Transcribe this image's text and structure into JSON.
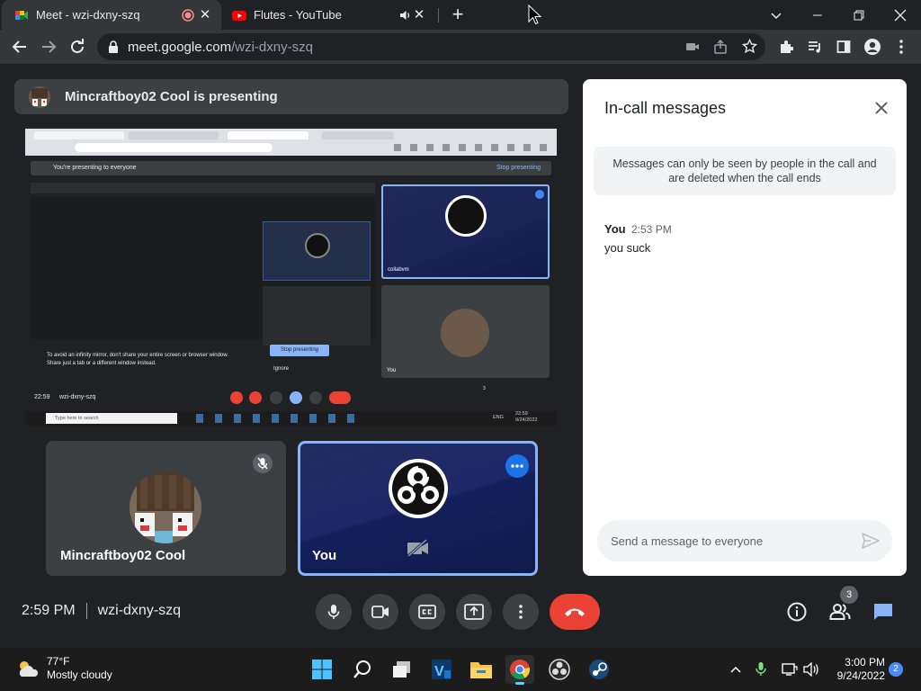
{
  "browser": {
    "tabs": [
      {
        "title": "Meet - wzi-dxny-szq",
        "active": true
      },
      {
        "title": "Flutes - YouTube",
        "active": false
      }
    ],
    "new_tab": "+",
    "url_host": "meet.google.com",
    "url_path": "/wzi-dxny-szq"
  },
  "meet": {
    "presenter_label": "Mincraftboy02 Cool is presenting",
    "shared_screen": {
      "banner": "You're presenting to everyone",
      "banner_button": "Stop presenting",
      "mirror_warning_1": "To avoid an infinity mirror, don't share your entire screen or browser window.",
      "mirror_warning_2": "Share just a tab or a different window instead.",
      "stop_button": "Stop presenting",
      "ignore_button": "Ignore",
      "clock": "22:59",
      "meeting_code": "wzi-dxny-szq",
      "tile_name_1": "collabvm",
      "tile_name_2": "You",
      "people_count": "3",
      "search_placeholder": "Type here to search",
      "tray_time": "22:59",
      "tray_date": "9/24/2022",
      "tray_lang": "ENG"
    },
    "tiles": [
      {
        "name": "Mincraftboy02 Cool",
        "muted": true
      },
      {
        "name": "You",
        "camera_off": true,
        "speaking_highlight": true
      }
    ],
    "chat": {
      "heading": "In-call messages",
      "notice": "Messages can only be seen by people in the call and are deleted when the call ends",
      "messages": [
        {
          "sender": "You",
          "time": "2:53 PM",
          "text": "you suck"
        }
      ],
      "placeholder": "Send a message to everyone"
    },
    "controls": {
      "time": "2:59 PM",
      "meeting_code": "wzi-dxny-szq",
      "people_count": "3"
    }
  },
  "taskbar": {
    "weather_temp": "77°F",
    "weather_desc": "Mostly cloudy",
    "time": "3:00 PM",
    "date": "9/24/2022",
    "notifications": "2"
  },
  "colors": {
    "accent_blue": "#8ab4f8",
    "end_call_red": "#ea4335",
    "tile_bg": "#3c4043",
    "page_bg": "#202124"
  }
}
